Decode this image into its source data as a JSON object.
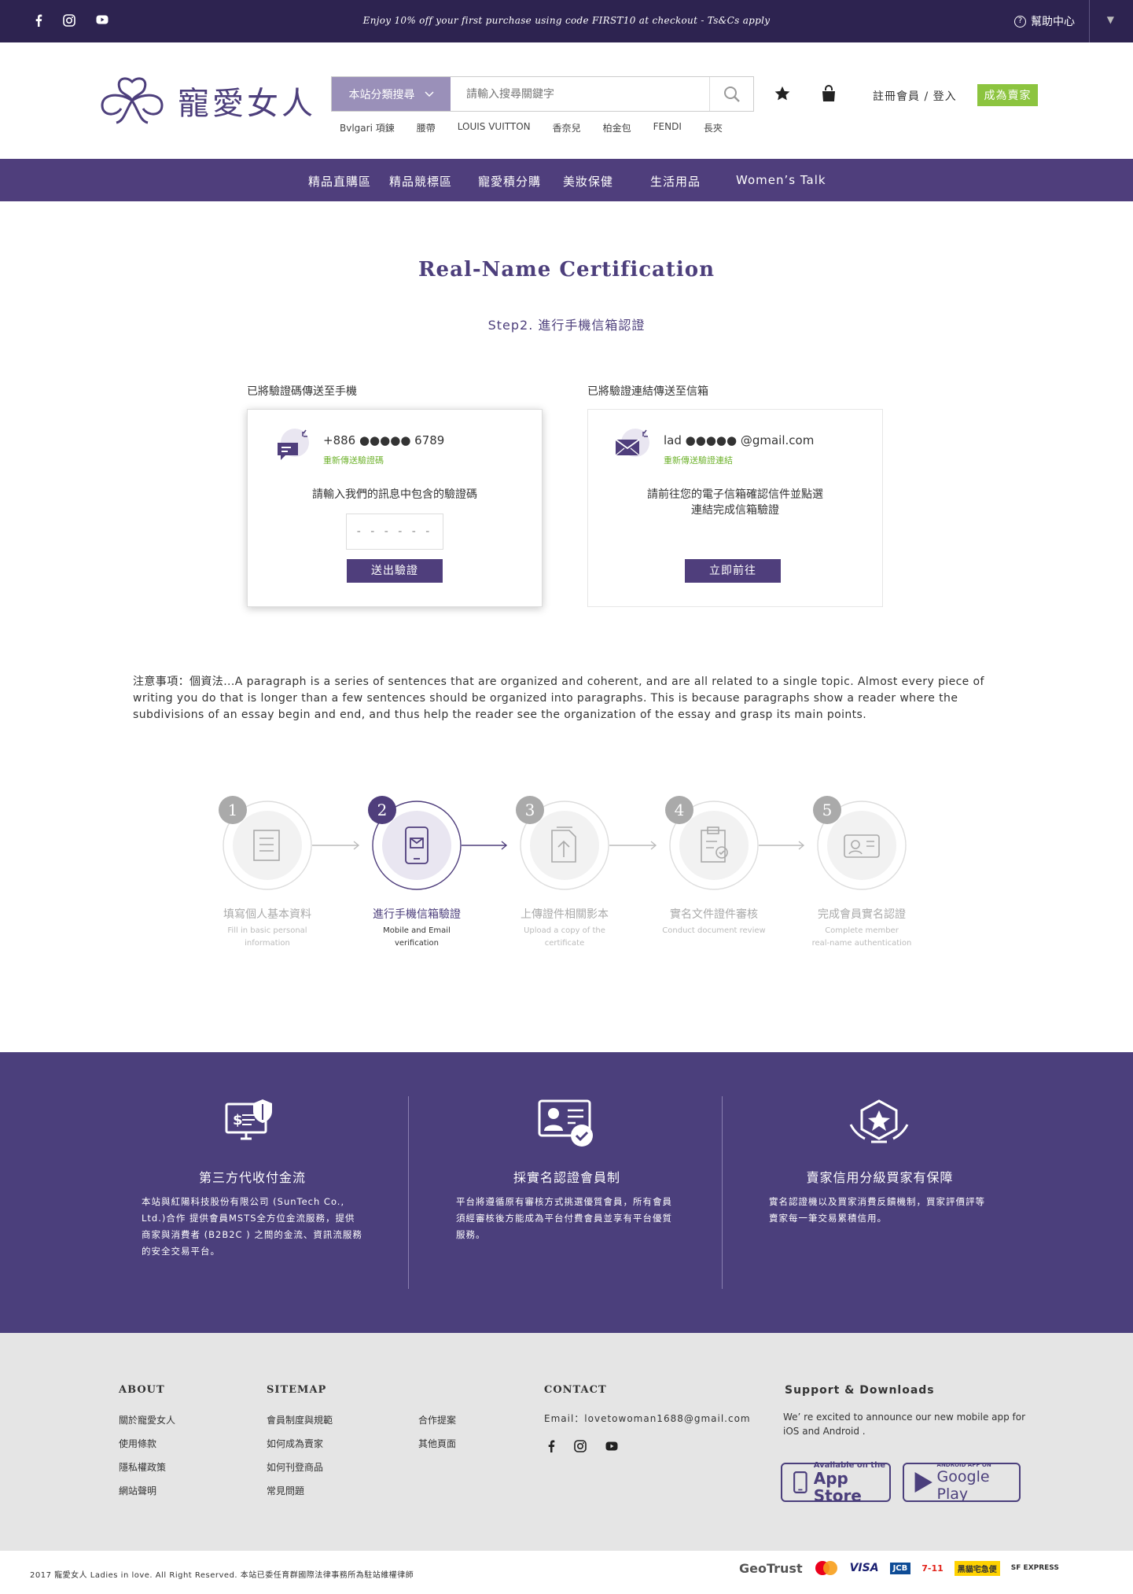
{
  "topbar": {
    "promo": "Enjoy 10% off your first purchase using code FIRST10 at checkout - Ts&Cs apply",
    "help": "幫助中心",
    "social_icons": [
      "facebook-icon",
      "instagram-icon",
      "youtube-icon"
    ]
  },
  "header": {
    "logo_text": "寵愛女人",
    "search_category": "本站分類搜尋",
    "search_placeholder": "請輸入搜尋關鍵字",
    "hot_keywords": [
      "Bvlgari 項鍊",
      "腰帶",
      "LOUIS VUITTON",
      "香奈兒",
      "柏金包",
      "FENDI",
      "長夾"
    ],
    "account": "註冊會員 / 登入",
    "seller_button": "成為賣家"
  },
  "nav": {
    "items": [
      "精品直購區",
      "精品競標區",
      "寵愛積分購",
      "美妝保健",
      "生活用品",
      "Women’s Talk"
    ]
  },
  "page": {
    "title": "Real-Name Certification",
    "subtitle": "Step2. 進行手機信箱認證"
  },
  "phone_card": {
    "heading": "已將驗證碼傳送至手機",
    "number": "+886 ●●●●● 6789",
    "resend": "重新傳送驗證碼",
    "instruction": "請輸入我們的訊息中包含的驗證碼",
    "code_placeholder": "- - - - - -",
    "submit": "送出驗證"
  },
  "email_card": {
    "heading": "已將驗證連結傳送至信箱",
    "email": "lad ●●●●● @gmail.com",
    "resend": "重新傳送驗證連結",
    "instruction_line1": "請前往您的電子信箱確認信件並點選",
    "instruction_line2": "連結完成信箱驗證",
    "go": "立即前往"
  },
  "notice": "注意事項：個資法...A paragraph is a series of sentences that are organized and coherent, and are all related to a single topic. Almost every piece of writing you do that is longer than a few sentences should be organized into paragraphs. This is because paragraphs show a reader where the subdivisions of an essay begin and end, and thus help the reader see the organization of the essay and grasp its main points.",
  "steps": {
    "current": 2,
    "items": [
      {
        "num": "1",
        "zh": "填寫個人基本資料",
        "en1": "Fill in basic personal",
        "en2": "information"
      },
      {
        "num": "2",
        "zh": "進行手機信箱驗證",
        "en1": "Mobile and Email",
        "en2": "verification"
      },
      {
        "num": "3",
        "zh": "上傳證件相關影本",
        "en1": "Upload a copy of the",
        "en2": "certificate"
      },
      {
        "num": "4",
        "zh": "實名文件證件審核",
        "en1": "Conduct document review",
        "en2": ""
      },
      {
        "num": "5",
        "zh": "完成會員實名認證",
        "en1": "Complete member",
        "en2": "real-name authentication"
      }
    ]
  },
  "features": [
    {
      "title": "第三方代收付金流",
      "desc": "本站與紅陽科技股份有限公司 (SunTech Co., Ltd.)合作 提供會員MSTS全方位金流服務，提供商家與消費者 (B2B2C ) 之間的金流、資訊流服務的安全交易平台。"
    },
    {
      "title": "採實名認證會員制",
      "desc": "平台將遵循原有審核方式挑選優質會員，所有會員須經審核後方能成為平台付費會員並享有平台優質服務。"
    },
    {
      "title": "賣家信用分級買家有保障",
      "desc": "實名認證機以及買家消費反饋機制，買家評價評等賣家每一筆交易累積信用。"
    }
  ],
  "footer": {
    "about_title": "ABOUT",
    "about_links": [
      "關於寵愛女人",
      "使用條款",
      "隱私權政策",
      "網站聲明"
    ],
    "sitemap_title": "SITEMAP",
    "sitemap_col1": [
      "會員制度與規範",
      "如何成為賣家",
      "如何刊登商品",
      "常見問題"
    ],
    "sitemap_col2": [
      "合作提案",
      "其他頁面"
    ],
    "contact_title": "CONTACT",
    "contact_email": "Email：lovetowoman1688@gmail.com",
    "support_title": "Support & Downloads",
    "support_desc": "We’ re excited to announce our new mobile app for iOS and Android .",
    "appstore_small": "Available on the",
    "appstore_big": "App Store",
    "googleplay_small": "ANDROID APP ON",
    "googleplay_big": "Google Play"
  },
  "bottom": {
    "copyright": "2017 寵愛女人 Ladies in love. All Right Reserved.   本站已委任育群國際法律事務所為駐站維權律師",
    "badges": [
      "GeoTrust",
      "MasterCard",
      "VISA",
      "JCB",
      "7-11",
      "黑貓宅急便",
      "SF EXPRESS"
    ]
  },
  "colors": {
    "brand_dark": "#2d2350",
    "brand": "#4f3e7c",
    "accent_green": "#8cc43f",
    "resend_green": "#6fb32e"
  }
}
